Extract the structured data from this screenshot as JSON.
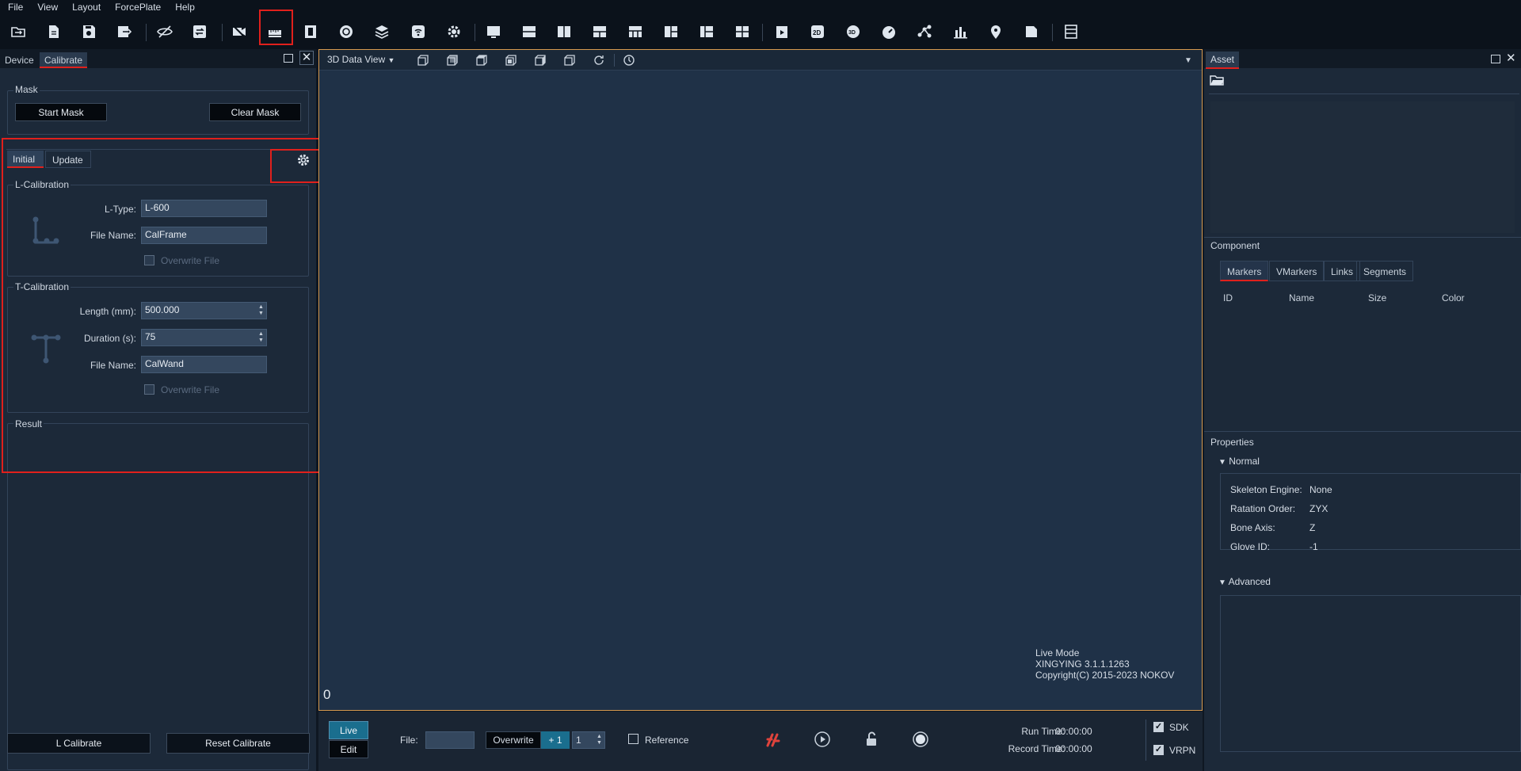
{
  "menu": [
    "File",
    "View",
    "Layout",
    "ForcePlate",
    "Help"
  ],
  "toolbar_icons": [
    "open-folder-icon",
    "new-file-icon",
    "save-icon",
    "export-icon",
    "hide-icon",
    "refresh-icon",
    "camera-off-icon",
    "calibrate-ruler-icon",
    "film-icon",
    "rotate-icon",
    "layers-icon",
    "wireless-icon",
    "settings-icon",
    "layout-single-icon",
    "layout-split-h-icon",
    "layout-split-v-icon",
    "layout-grid-icon",
    "layout-top-icon",
    "layout-left-icon",
    "layout-quad-icon",
    "playback-icon",
    "2d-icon",
    "3d-icon",
    "gauge-icon",
    "skeleton-icon",
    "chart-icon",
    "pin-icon",
    "document-icon",
    "list-icon"
  ],
  "left": {
    "tabs": [
      "Device",
      "Calibrate"
    ],
    "mask": {
      "title": "Mask",
      "start": "Start Mask",
      "clear": "Clear Mask"
    },
    "subtabs": [
      "Initial",
      "Update"
    ],
    "lcal": {
      "title": "L-Calibration",
      "ltype_label": "L-Type:",
      "ltype_value": "L-600",
      "file_label": "File Name:",
      "file_value": "CalFrame",
      "overwrite": "Overwrite File"
    },
    "tcal": {
      "title": "T-Calibration",
      "length_label": "Length (mm):",
      "length_value": "500.000",
      "duration_label": "Duration (s):",
      "duration_value": "75",
      "file_label": "File Name:",
      "file_value": "CalWand",
      "overwrite": "Overwrite File"
    },
    "result_title": "Result",
    "l_calibrate": "L Calibrate",
    "reset_calibrate": "Reset Calibrate"
  },
  "view": {
    "title": "3D Data View",
    "frame": "0",
    "info_mode": "Live Mode",
    "info_version": "XINGYING 3.1.1.1263",
    "info_copyright": "Copyright(C) 2015-2023 NOKOV"
  },
  "bottom": {
    "live": "Live",
    "edit": "Edit",
    "file_label": "File:",
    "overwrite": "Overwrite",
    "plus": "+ 1",
    "spin": "1",
    "reference": "Reference",
    "run_time_label": "Run Time:",
    "run_time": "00:00:00",
    "record_time_label": "Record Time:",
    "record_time": "00:00:00",
    "sdk": "SDK",
    "vrpn": "VRPN"
  },
  "right": {
    "tab": "Asset",
    "component_title": "Component",
    "comp_tabs": [
      "Markers",
      "VMarkers",
      "Links",
      "Segments"
    ],
    "columns": [
      "ID",
      "Name",
      "Size",
      "Color"
    ],
    "properties_title": "Properties",
    "normal": "Normal",
    "props": [
      {
        "k": "Skeleton Engine:",
        "v": "None"
      },
      {
        "k": "Ratation Order:",
        "v": "ZYX"
      },
      {
        "k": "Bone Axis:",
        "v": "Z"
      },
      {
        "k": "Glove ID:",
        "v": "-1"
      }
    ],
    "advanced": "Advanced"
  }
}
